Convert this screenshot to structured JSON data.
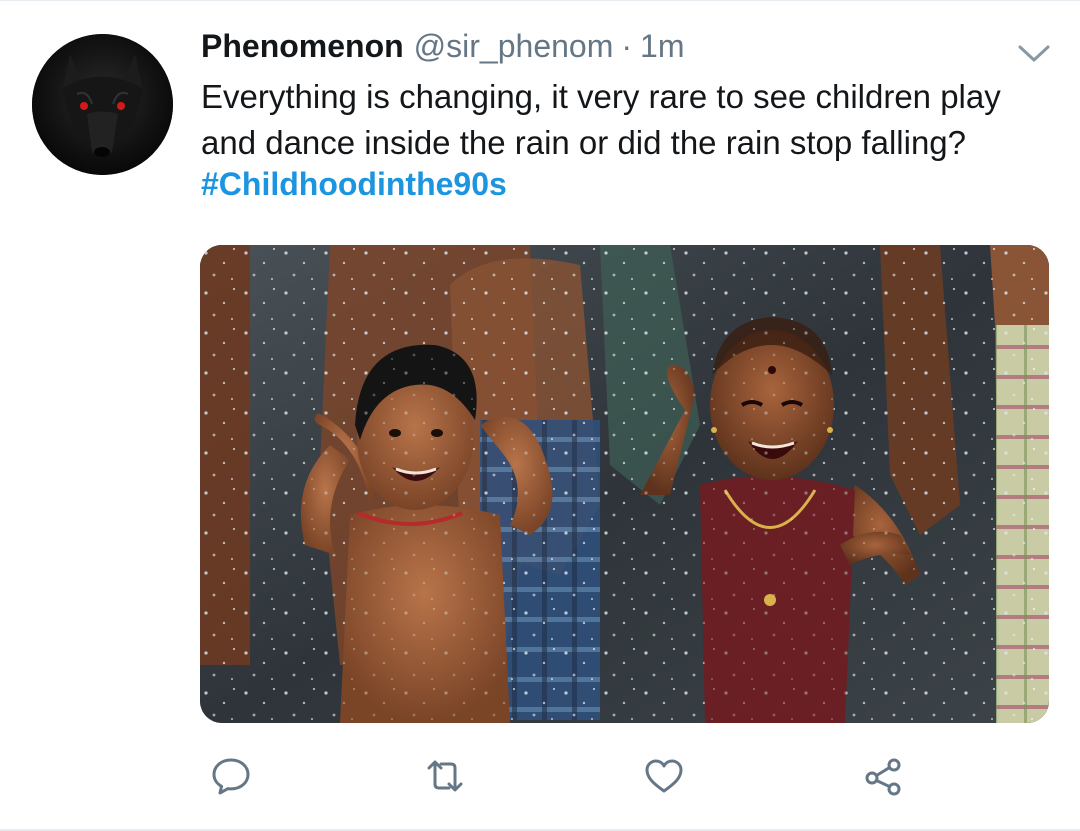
{
  "tweet": {
    "author": {
      "display_name": "Phenomenon",
      "handle": "@sir_phenom"
    },
    "separator": "·",
    "timestamp": "1m",
    "text": "Everything is changing, it very rare to see children play and dance inside the rain or did the rain stop falling?",
    "hashtag": "#Childhoodinthe90s"
  },
  "icons": {
    "menu": "chevron-down-icon",
    "reply": "reply-icon",
    "retweet": "retweet-icon",
    "like": "heart-icon",
    "share": "share-icon"
  },
  "colors": {
    "link": "#1b95e0",
    "secondary_text": "#657786",
    "icon": "#657786",
    "divider": "#e6ecf0"
  }
}
